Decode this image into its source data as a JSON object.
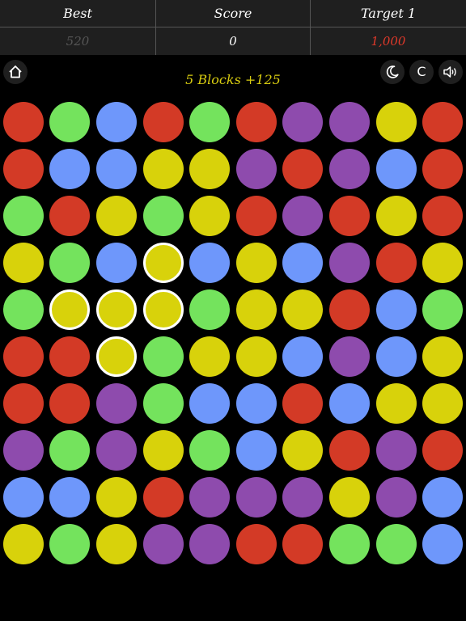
{
  "header": {
    "best_label": "Best",
    "score_label": "Score",
    "target_label": "Target 1",
    "best_value": "520",
    "score_value": "0",
    "target_value": "1,000"
  },
  "toolbar": {
    "home_icon": "home-icon",
    "night_icon": "moon-icon",
    "c_label": "C",
    "sound_icon": "speaker-icon"
  },
  "selection": {
    "text": "5 Blocks +125"
  },
  "colors": {
    "R": "#d33a26",
    "G": "#74e35d",
    "B": "#6e97fb",
    "Y": "#d8d20b",
    "P": "#8e4bad"
  },
  "board": {
    "columns": 10,
    "rows": 10,
    "grid": [
      [
        "R",
        "G",
        "B",
        "R",
        "G",
        "R",
        "P",
        "P",
        "Y",
        "R"
      ],
      [
        "R",
        "B",
        "B",
        "Y",
        "Y",
        "P",
        "R",
        "P",
        "B",
        "R"
      ],
      [
        "G",
        "R",
        "Y",
        "G",
        "Y",
        "R",
        "P",
        "R",
        "Y",
        "R"
      ],
      [
        "Y",
        "G",
        "B",
        "Y",
        "B",
        "Y",
        "B",
        "P",
        "R",
        "Y"
      ],
      [
        "G",
        "Y",
        "Y",
        "Y",
        "G",
        "Y",
        "Y",
        "R",
        "B",
        "G"
      ],
      [
        "R",
        "R",
        "Y",
        "G",
        "Y",
        "Y",
        "B",
        "P",
        "B",
        "Y"
      ],
      [
        "R",
        "R",
        "P",
        "G",
        "B",
        "B",
        "R",
        "B",
        "Y",
        "Y"
      ],
      [
        "P",
        "G",
        "P",
        "Y",
        "G",
        "B",
        "Y",
        "R",
        "P",
        "R"
      ],
      [
        "B",
        "B",
        "Y",
        "R",
        "P",
        "P",
        "P",
        "Y",
        "P",
        "B"
      ],
      [
        "Y",
        "G",
        "Y",
        "P",
        "P",
        "R",
        "R",
        "G",
        "G",
        "B"
      ]
    ],
    "selected": [
      [
        3,
        3
      ],
      [
        4,
        1
      ],
      [
        4,
        2
      ],
      [
        4,
        3
      ],
      [
        5,
        2
      ]
    ]
  }
}
